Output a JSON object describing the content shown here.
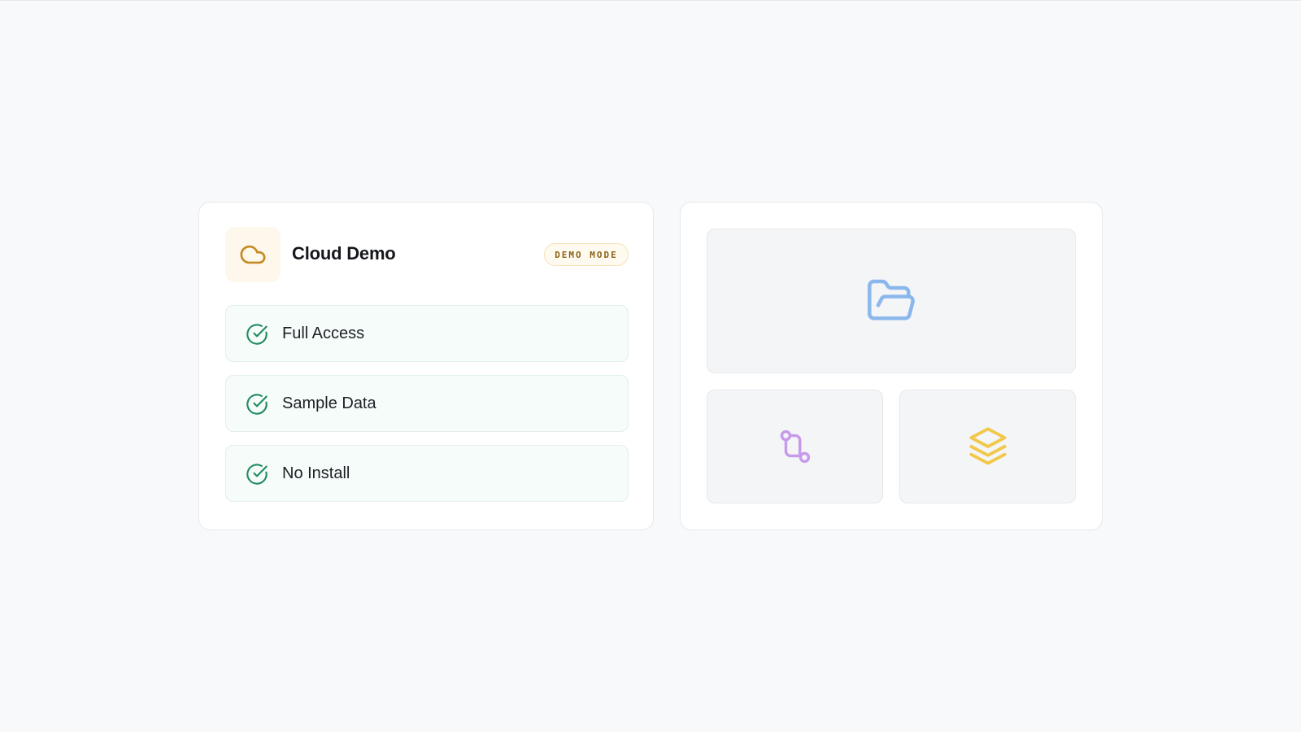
{
  "demo_card": {
    "title": "Cloud Demo",
    "icon": "cloud-icon",
    "badge": "DEMO MODE",
    "features": [
      {
        "label": "Full Access",
        "icon": "check-circle-icon"
      },
      {
        "label": "Sample Data",
        "icon": "check-circle-icon"
      },
      {
        "label": "No Install",
        "icon": "check-circle-icon"
      }
    ]
  },
  "preview_card": {
    "tiles": [
      {
        "icon": "folder-open-icon",
        "color": "#8bb8ec"
      },
      {
        "icon": "git-pull-request-icon",
        "color": "#c79aec"
      },
      {
        "icon": "layers-icon",
        "color": "#f2c84a"
      }
    ]
  },
  "colors": {
    "accent_amber": "#c58a23",
    "success_green": "#1f8a5f",
    "background": "#f8f9fb"
  }
}
